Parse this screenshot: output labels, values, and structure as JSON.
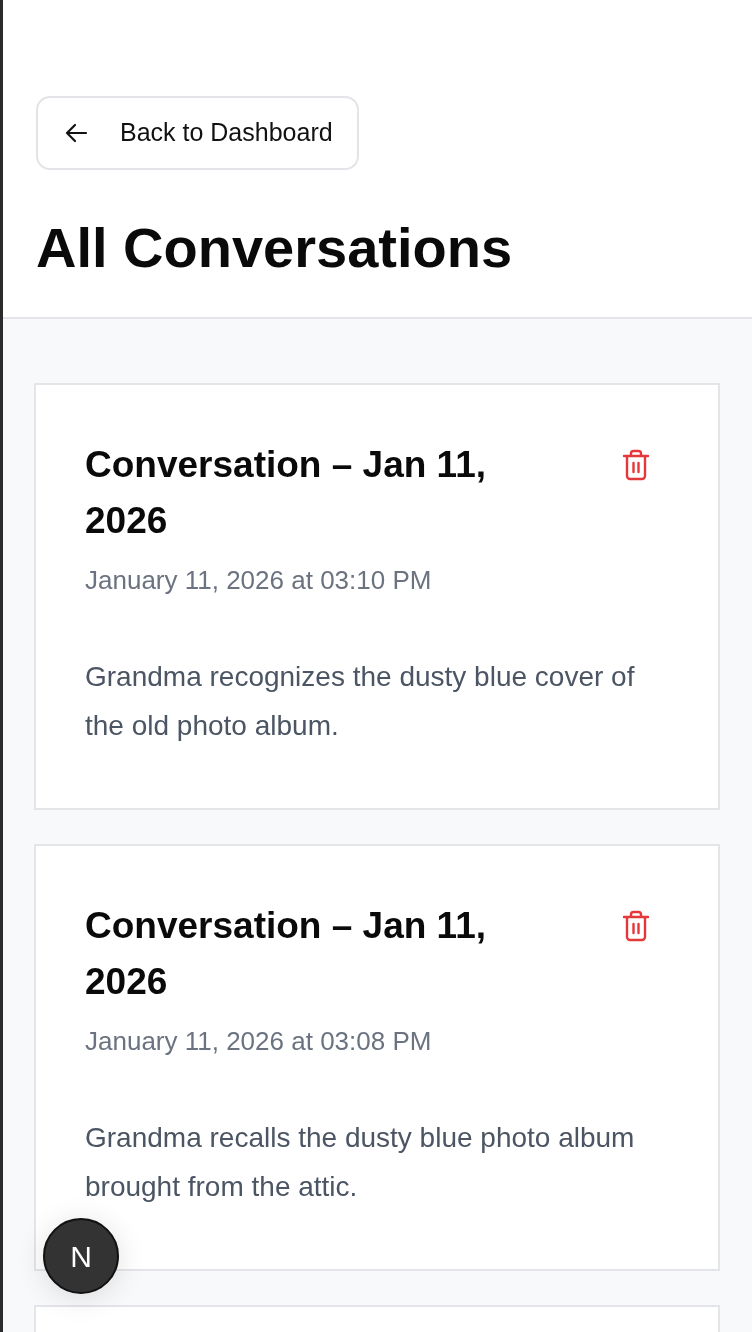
{
  "back_button": {
    "label": "Back to Dashboard"
  },
  "page_title": "All Conversations",
  "conversations": [
    {
      "title": "Conversation – Jan 11, 2026",
      "timestamp": "January 11, 2026 at 03:10 PM",
      "summary": "Grandma recognizes the dusty blue cover of the old photo album."
    },
    {
      "title": "Conversation – Jan 11, 2026",
      "timestamp": "January 11, 2026 at 03:08 PM",
      "summary": "Grandma recalls the dusty blue photo album brought from the attic."
    }
  ],
  "dev_badge": {
    "label": "N"
  }
}
